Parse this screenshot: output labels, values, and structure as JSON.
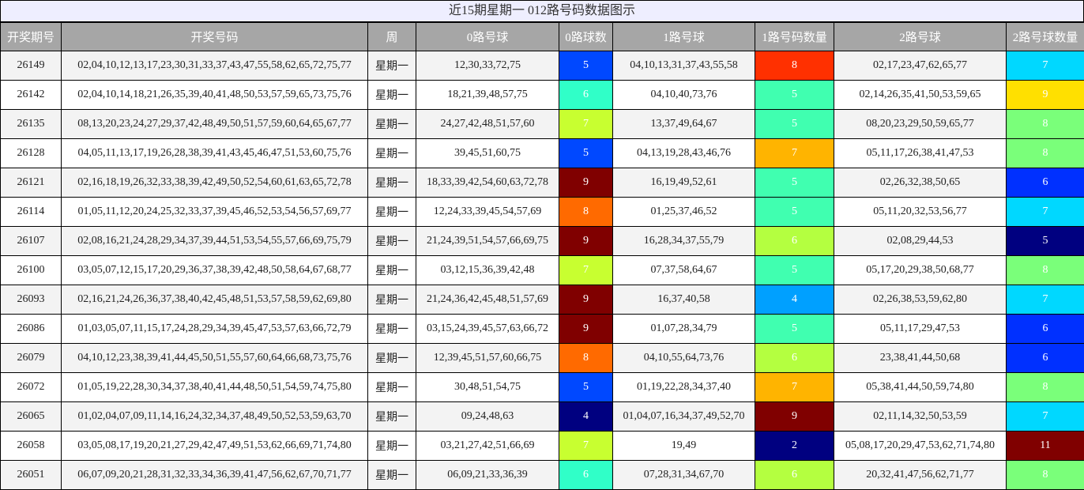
{
  "title": "近15期星期一 012路号码数据图示",
  "headers": [
    "开奖期号",
    "开奖号码",
    "周",
    "0路号球",
    "0路球数",
    "1路号球",
    "1路号码数量",
    "2路号球",
    "2路号球数量"
  ],
  "count_colors": {
    "2": "#000080",
    "4": "#00a0ff",
    "5": "#0040ff",
    "6": "#33ffc8",
    "7": "#c8ff33",
    "8": "#ff6a00",
    "9": "#800000",
    "11": "#800000"
  },
  "rows": [
    {
      "issue": "26149",
      "numbers": "02,04,10,12,13,17,23,30,31,33,37,43,47,55,58,62,65,72,75,77",
      "week": "星期一",
      "r0": "12,30,33,72,75",
      "c0": "5",
      "r0_color": "#0048ff",
      "r1": "04,10,13,31,37,43,55,58",
      "c1": "8",
      "r1_color": "#ff3000",
      "r2": "02,17,23,47,62,65,77",
      "c2": "7",
      "r2_color": "#00d8ff"
    },
    {
      "issue": "26142",
      "numbers": "02,04,10,14,18,21,26,35,39,40,41,48,50,53,57,59,65,73,75,76",
      "week": "星期一",
      "r0": "18,21,39,48,57,75",
      "c0": "6",
      "r0_color": "#30ffc8",
      "r1": "04,10,40,73,76",
      "c1": "5",
      "r1_color": "#40ffb0",
      "r2": "02,14,26,35,41,50,53,59,65",
      "c2": "9",
      "r2_color": "#ffe000"
    },
    {
      "issue": "26135",
      "numbers": "08,13,20,23,24,27,29,37,42,48,49,50,51,57,59,60,64,65,67,77",
      "week": "星期一",
      "r0": "24,27,42,48,51,57,60",
      "c0": "7",
      "r0_color": "#c8ff30",
      "r1": "13,37,49,64,67",
      "c1": "5",
      "r1_color": "#40ffb0",
      "r2": "08,20,23,29,50,59,65,77",
      "c2": "8",
      "r2_color": "#7aff7a"
    },
    {
      "issue": "26128",
      "numbers": "04,05,11,13,17,19,26,28,38,39,41,43,45,46,47,51,53,60,75,76",
      "week": "星期一",
      "r0": "39,45,51,60,75",
      "c0": "5",
      "r0_color": "#0048ff",
      "r1": "04,13,19,28,43,46,76",
      "c1": "7",
      "r1_color": "#ffb400",
      "r2": "05,11,17,26,38,41,47,53",
      "c2": "8",
      "r2_color": "#7aff7a"
    },
    {
      "issue": "26121",
      "numbers": "02,16,18,19,26,32,33,38,39,42,49,50,52,54,60,61,63,65,72,78",
      "week": "星期一",
      "r0": "18,33,39,42,54,60,63,72,78",
      "c0": "9",
      "r0_color": "#800000",
      "r1": "16,19,49,52,61",
      "c1": "5",
      "r1_color": "#40ffb0",
      "r2": "02,26,32,38,50,65",
      "c2": "6",
      "r2_color": "#0030ff"
    },
    {
      "issue": "26114",
      "numbers": "01,05,11,12,20,24,25,32,33,37,39,45,46,52,53,54,56,57,69,77",
      "week": "星期一",
      "r0": "12,24,33,39,45,54,57,69",
      "c0": "8",
      "r0_color": "#ff6a00",
      "r1": "01,25,37,46,52",
      "c1": "5",
      "r1_color": "#40ffb0",
      "r2": "05,11,20,32,53,56,77",
      "c2": "7",
      "r2_color": "#00d8ff"
    },
    {
      "issue": "26107",
      "numbers": "02,08,16,21,24,28,29,34,37,39,44,51,53,54,55,57,66,69,75,79",
      "week": "星期一",
      "r0": "21,24,39,51,54,57,66,69,75",
      "c0": "9",
      "r0_color": "#800000",
      "r1": "16,28,34,37,55,79",
      "c1": "6",
      "r1_color": "#b4ff40",
      "r2": "02,08,29,44,53",
      "c2": "5",
      "r2_color": "#000080"
    },
    {
      "issue": "26100",
      "numbers": "03,05,07,12,15,17,20,29,36,37,38,39,42,48,50,58,64,67,68,77",
      "week": "星期一",
      "r0": "03,12,15,36,39,42,48",
      "c0": "7",
      "r0_color": "#c8ff30",
      "r1": "07,37,58,64,67",
      "c1": "5",
      "r1_color": "#40ffb0",
      "r2": "05,17,20,29,38,50,68,77",
      "c2": "8",
      "r2_color": "#7aff7a"
    },
    {
      "issue": "26093",
      "numbers": "02,16,21,24,26,36,37,38,40,42,45,48,51,53,57,58,59,62,69,80",
      "week": "星期一",
      "r0": "21,24,36,42,45,48,51,57,69",
      "c0": "9",
      "r0_color": "#800000",
      "r1": "16,37,40,58",
      "c1": "4",
      "r1_color": "#00a0ff",
      "r2": "02,26,38,53,59,62,80",
      "c2": "7",
      "r2_color": "#00d8ff"
    },
    {
      "issue": "26086",
      "numbers": "01,03,05,07,11,15,17,24,28,29,34,39,45,47,53,57,63,66,72,79",
      "week": "星期一",
      "r0": "03,15,24,39,45,57,63,66,72",
      "c0": "9",
      "r0_color": "#800000",
      "r1": "01,07,28,34,79",
      "c1": "5",
      "r1_color": "#40ffb0",
      "r2": "05,11,17,29,47,53",
      "c2": "6",
      "r2_color": "#0030ff"
    },
    {
      "issue": "26079",
      "numbers": "04,10,12,23,38,39,41,44,45,50,51,55,57,60,64,66,68,73,75,76",
      "week": "星期一",
      "r0": "12,39,45,51,57,60,66,75",
      "c0": "8",
      "r0_color": "#ff6a00",
      "r1": "04,10,55,64,73,76",
      "c1": "6",
      "r1_color": "#b4ff40",
      "r2": "23,38,41,44,50,68",
      "c2": "6",
      "r2_color": "#0030ff"
    },
    {
      "issue": "26072",
      "numbers": "01,05,19,22,28,30,34,37,38,40,41,44,48,50,51,54,59,74,75,80",
      "week": "星期一",
      "r0": "30,48,51,54,75",
      "c0": "5",
      "r0_color": "#0048ff",
      "r1": "01,19,22,28,34,37,40",
      "c1": "7",
      "r1_color": "#ffb400",
      "r2": "05,38,41,44,50,59,74,80",
      "c2": "8",
      "r2_color": "#7aff7a"
    },
    {
      "issue": "26065",
      "numbers": "01,02,04,07,09,11,14,16,24,32,34,37,48,49,50,52,53,59,63,70",
      "week": "星期一",
      "r0": "09,24,48,63",
      "c0": "4",
      "r0_color": "#000080",
      "r1": "01,04,07,16,34,37,49,52,70",
      "c1": "9",
      "r1_color": "#800000",
      "r2": "02,11,14,32,50,53,59",
      "c2": "7",
      "r2_color": "#00d8ff"
    },
    {
      "issue": "26058",
      "numbers": "03,05,08,17,19,20,21,27,29,42,47,49,51,53,62,66,69,71,74,80",
      "week": "星期一",
      "r0": "03,21,27,42,51,66,69",
      "c0": "7",
      "r0_color": "#c8ff30",
      "r1": "19,49",
      "c1": "2",
      "r1_color": "#000080",
      "r2": "05,08,17,20,29,47,53,62,71,74,80",
      "c2": "11",
      "r2_color": "#800000"
    },
    {
      "issue": "26051",
      "numbers": "06,07,09,20,21,28,31,32,33,34,36,39,41,47,56,62,67,70,71,77",
      "week": "星期一",
      "r0": "06,09,21,33,36,39",
      "c0": "6",
      "r0_color": "#30ffc8",
      "r1": "07,28,31,34,67,70",
      "c1": "6",
      "r1_color": "#b4ff40",
      "r2": "20,32,41,47,56,62,71,77",
      "c2": "8",
      "r2_color": "#7aff7a"
    }
  ]
}
